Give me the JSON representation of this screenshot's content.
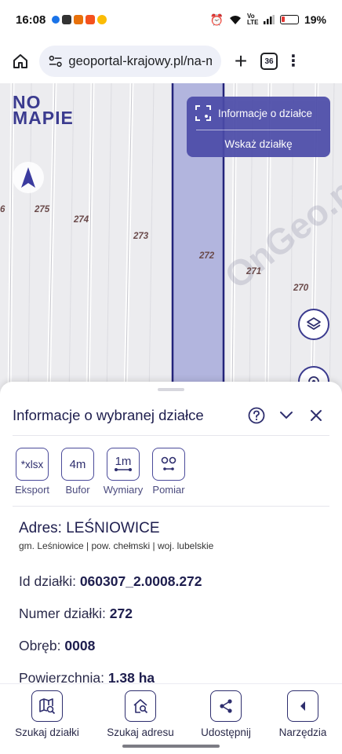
{
  "status": {
    "time": "16:08",
    "battery": "19%",
    "network": "Vo LTE"
  },
  "browser": {
    "url": "geoportal-krajowy.pl/na-m",
    "tab_count": "36"
  },
  "map": {
    "logo": {
      "line1": "NO",
      "line2": "MAPIE"
    },
    "info_panel": {
      "title": "Informacje o działce",
      "action": "Wskaż działkę"
    },
    "parcel_labels": [
      "6",
      "275",
      "274",
      "273",
      "272",
      "271",
      "270"
    ],
    "watermark": "OnGeo.pl"
  },
  "sheet": {
    "title": "Informacje o wybranej działce",
    "tools": [
      {
        "symbol": "*xlsx",
        "label": "Eksport"
      },
      {
        "symbol": "4m",
        "label": "Bufor"
      },
      {
        "symbol": "1m",
        "label": "Wymiary"
      },
      {
        "symbol": "",
        "label": "Pomiar"
      }
    ],
    "address": "Adres: LEŚNIOWICE",
    "admin": "gm. Leśniowice | pow. chełmski | woj. lubelskie",
    "fields": [
      {
        "label": "Id działki: ",
        "value": "060307_2.0008.272"
      },
      {
        "label": "Numer działki: ",
        "value": "272"
      },
      {
        "label": "Obręb: ",
        "value": "0008"
      },
      {
        "label": "Powierzchnia: ",
        "value": "1.38 ha"
      }
    ]
  },
  "nav": [
    {
      "label": "Szukaj działki"
    },
    {
      "label": "Szukaj adresu"
    },
    {
      "label": "Udostępnij"
    },
    {
      "label": "Narzędzia"
    }
  ],
  "colors": {
    "accent": "#3b3b8f",
    "panel": "#4b4ba8",
    "highlight": "#9fa3d8"
  }
}
